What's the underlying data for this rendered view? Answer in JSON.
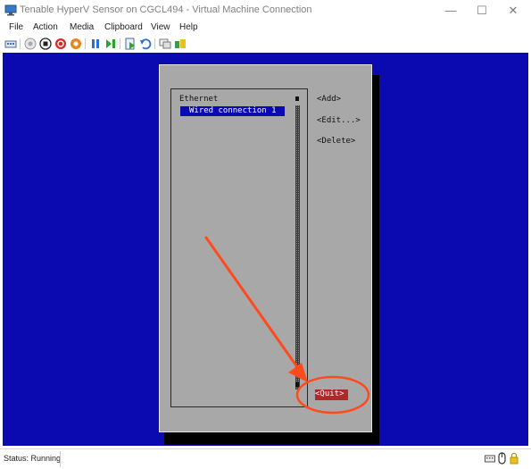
{
  "window": {
    "title": "Tenable HyperV Sensor on CGCL494 - Virtual Machine Connection",
    "minimize_glyph": "—",
    "maximize_glyph": "☐",
    "close_glyph": "✕"
  },
  "menu": [
    "File",
    "Action",
    "Media",
    "Clipboard",
    "View",
    "Help"
  ],
  "toolbar": {
    "icons": [
      "ctrl-alt-del-icon",
      "start-icon",
      "turn-off-icon",
      "shut-down-icon",
      "save-icon",
      "pause-icon",
      "reset-icon",
      "checkpoint-icon",
      "revert-icon",
      "enhanced-session-icon",
      "share-icon"
    ]
  },
  "nmtui": {
    "section": "Ethernet",
    "connections": [
      "Wired connection 1"
    ],
    "add_label": "<Add>",
    "edit_label": "<Edit...>",
    "delete_label": "<Delete>",
    "quit_label": "<Quit>"
  },
  "status": {
    "text": "Status: Running"
  },
  "colors": {
    "console_blue": "#0a0ab0",
    "dialog_gray": "#a8a8a8",
    "quit_red": "#b02828",
    "annotation": "#ff4a1c"
  }
}
